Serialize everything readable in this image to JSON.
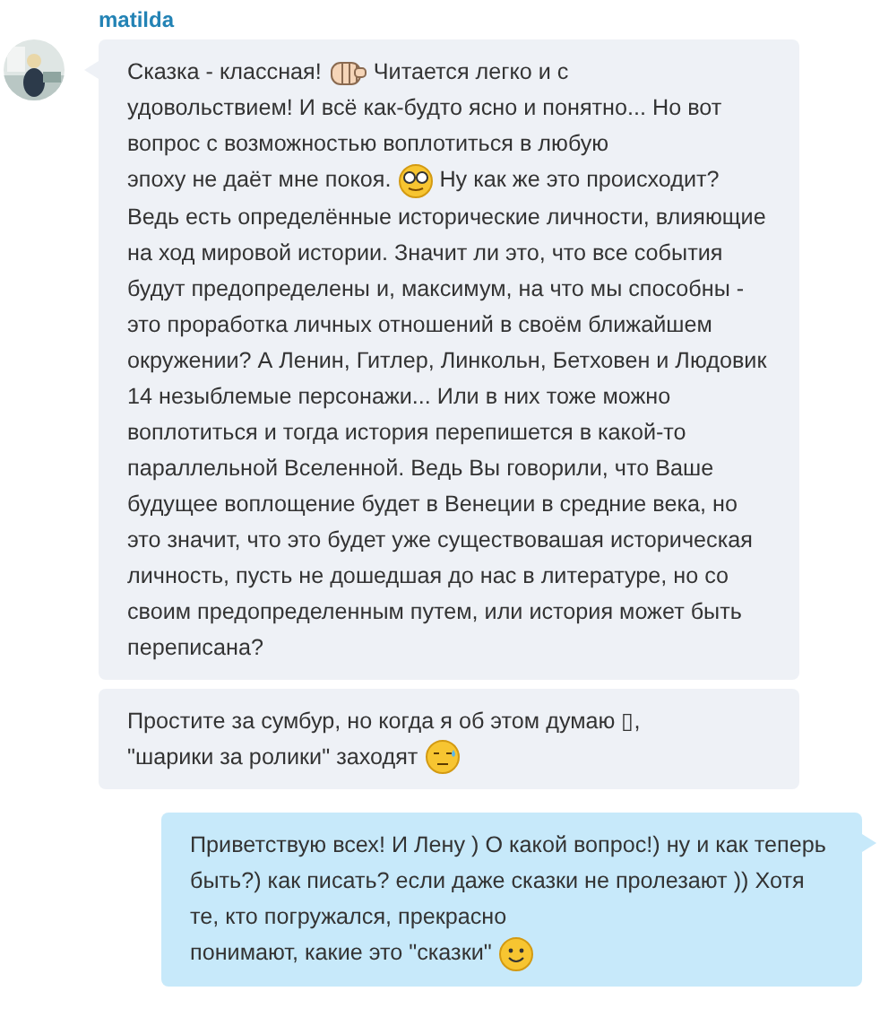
{
  "messages": [
    {
      "sender": "matilda",
      "outgoing": false,
      "avatar": {
        "kind": "picture"
      },
      "bubbles": [
        {
          "lines": [
            [
              {
                "kind": "text",
                "text": "Сказка - классная!"
              },
              {
                "kind": "fist"
              },
              {
                "kind": "text",
                "text": "Читается легко и с"
              }
            ],
            [
              {
                "kind": "text",
                "text": "удовольствием! И всё как-будто ясно и понятно... Но вот вопрос с возможностью воплотиться в любую"
              }
            ],
            [
              {
                "kind": "text",
                "text": "эпоху не даёт мне покоя."
              },
              {
                "kind": "nerd"
              },
              {
                "kind": "text",
                "text": "Ну как же это происходит?"
              }
            ],
            [
              {
                "kind": "text",
                "text": "Ведь есть определённые исторические личности, влияющие на ход мировой истории. Значит ли это, что все события будут предопределены и, максимум, на что мы способны - это проработка личных отношений в своём ближайшем окружении? А Ленин, Гитлер, Линкольн, Бетховен и Людовик 14 незыблемые персонажи... Или в них тоже можно воплотиться и тогда история перепишется в какой-то параллельной Вселенной. Ведь Вы говорили, что Ваше будущее воплощение будет в Венеции в средние века, но это значит, что это будет уже существовашая историческая личность, пусть не дошедшая до нас в   литературе, но со своим предопределенным путем, или история может быть переписана?"
              }
            ]
          ]
        },
        {
          "lines": [
            [
              {
                "kind": "text",
                "text": "Простите за сумбур, но когда я об этом думаю ▯,"
              }
            ],
            [
              {
                "kind": "text",
                "text": "\"шарики за ролики\" заходят"
              },
              {
                "kind": "sweat"
              }
            ]
          ]
        }
      ]
    },
    {
      "outgoing": true,
      "bubbles": [
        {
          "lines": [
            [
              {
                "kind": "text",
                "text": "Приветствую всех! И Лену ) О какой вопрос!) ну и как теперь быть?) как писать? если даже сказки не пролезают )) Хотя те, кто погружался, прекрасно"
              }
            ],
            [
              {
                "kind": "text",
                "text": "понимают, какие это \"сказки\""
              },
              {
                "kind": "smile"
              }
            ]
          ]
        }
      ]
    }
  ]
}
